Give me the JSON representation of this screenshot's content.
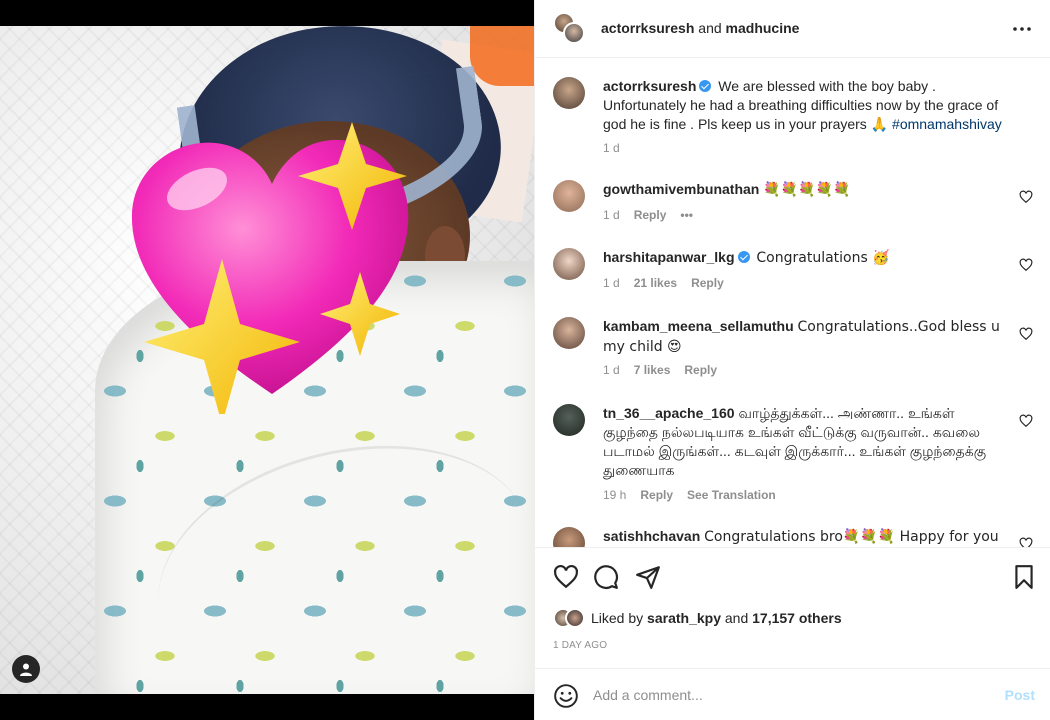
{
  "post": {
    "header_user1": "actorrksuresh",
    "header_and": "and",
    "header_user2": "madhucine"
  },
  "caption": {
    "user": "actorrksuresh",
    "text": "We are blessed with the boy baby . Unfortunately he had a breathing difficulties now by the grace of god he is fine . Pls keep us in your prayers",
    "emoji": "🙏",
    "hashtag": "#omnamahshivay",
    "time": "1 d"
  },
  "comments": [
    {
      "user": "gowthamivembunathan",
      "text": "💐💐💐💐💐",
      "time": "1 d",
      "likes": "",
      "reply": "Reply",
      "translate": "",
      "more": "•••"
    },
    {
      "user": "harshitapanwar_lkg",
      "text": "Congratulations 🥳",
      "time": "1 d",
      "likes": "21 likes",
      "reply": "Reply",
      "translate": ""
    },
    {
      "user": "kambam_meena_sellamuthu",
      "text": "Congratulations..God bless u my child 😍",
      "time": "1 d",
      "likes": "7 likes",
      "reply": "Reply",
      "translate": ""
    },
    {
      "user": "tn_36__apache_160",
      "text": "வாழ்த்துக்கள்... அண்ணா.. உங்கள் குழந்தை நல்லபடியாக உங்கள் வீட்டுக்கு வருவான்.. கவலை படாமல் இருங்கள்... கடவுள் இருக்கார்... உங்கள் குழந்தைக்கு துணையாக",
      "time": "19 h",
      "likes": "",
      "reply": "Reply",
      "translate": "See Translation"
    },
    {
      "user": "satishhchavan",
      "text": "Congratulations bro💐💐💐 Happy for you",
      "time": "",
      "likes": "",
      "reply": "",
      "translate": ""
    }
  ],
  "likes": {
    "prefix": "Liked by",
    "user": "sarath_kpy",
    "and": "and",
    "count": "17,157 others"
  },
  "timestamp": "1 DAY AGO",
  "add_comment": {
    "placeholder": "Add a comment...",
    "post_label": "Post"
  },
  "icons": {
    "like": "heart-icon",
    "comment": "comment-icon",
    "share": "share-icon",
    "save": "bookmark-icon",
    "more": "more-icon",
    "emoji": "emoji-icon",
    "user_tag": "user-tag-icon"
  },
  "colors": {
    "link": "#00376b",
    "verified": "#3897f0",
    "muted": "#8e8e8e",
    "post_disabled": "#b2dffc"
  }
}
